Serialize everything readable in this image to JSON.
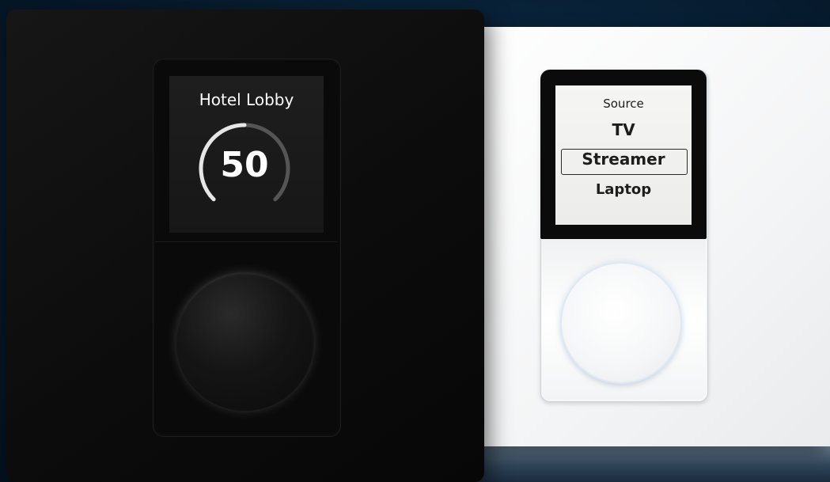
{
  "black_keypad": {
    "title": "Hotel Lobby",
    "volume_value": "50",
    "volume_fraction": 0.5
  },
  "white_keypad": {
    "menu_title": "Source",
    "options": [
      "TV",
      "Streamer",
      "Laptop"
    ],
    "selected": "Streamer"
  },
  "colors": {
    "background": "#061a2c",
    "black_panel": "#0c0c0c",
    "white_panel": "#f4f5f6",
    "gauge_active": "#e6e6e6",
    "gauge_track": "#555555"
  }
}
